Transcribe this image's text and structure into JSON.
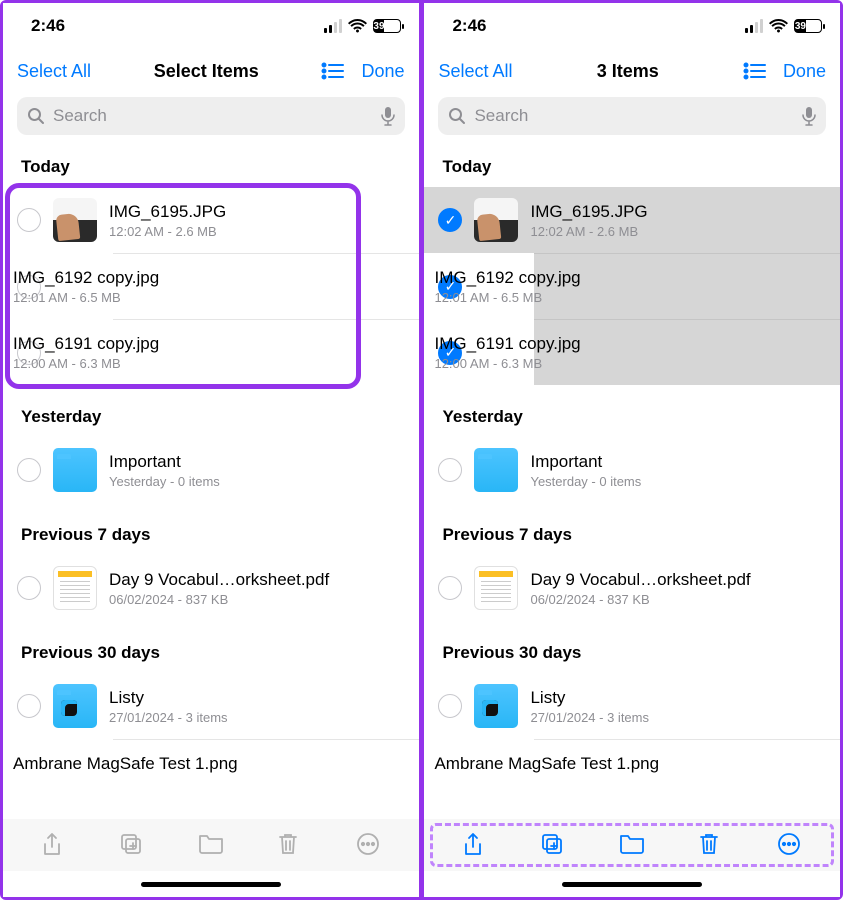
{
  "status": {
    "time": "2:46",
    "battery_text": "39",
    "battery_pct": 39
  },
  "nav": {
    "select_all": "Select All",
    "done": "Done",
    "title_left": "Select Items",
    "title_right": "3 Items"
  },
  "search": {
    "placeholder": "Search"
  },
  "sections": {
    "today": "Today",
    "yesterday": "Yesterday",
    "prev7": "Previous 7 days",
    "prev30": "Previous 30 days"
  },
  "items": {
    "today": [
      {
        "title": "IMG_6195.JPG",
        "sub": "12:02 AM - 2.6 MB"
      },
      {
        "title": "IMG_6192 copy.jpg",
        "sub": "12:01 AM - 6.5 MB"
      },
      {
        "title": "IMG_6191 copy.jpg",
        "sub": "12:00 AM - 6.3 MB"
      }
    ],
    "yesterday": [
      {
        "title": "Important",
        "sub": "Yesterday - 0 items"
      }
    ],
    "prev7": [
      {
        "title": "Day 9 Vocabul…orksheet.pdf",
        "sub": "06/02/2024 - 837 KB"
      }
    ],
    "prev30": [
      {
        "title": "Listy",
        "sub": "27/01/2024 - 3 items"
      },
      {
        "title": "Ambrane MagSafe Test 1.png",
        "sub": ""
      }
    ]
  }
}
